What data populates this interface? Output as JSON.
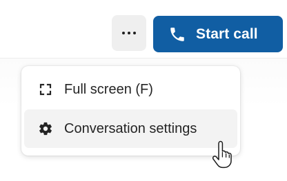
{
  "toolbar": {
    "more_icon": "more-horizontal-icon",
    "start_call": {
      "icon": "phone-icon",
      "label": "Start call",
      "color": "#115ea3"
    }
  },
  "menu": {
    "items": [
      {
        "icon": "full-screen-icon",
        "label": "Full screen (F)"
      },
      {
        "icon": "gear-icon",
        "label": "Conversation settings",
        "hovered": true
      }
    ]
  },
  "cursor": {
    "icon": "hand-pointer-icon"
  }
}
